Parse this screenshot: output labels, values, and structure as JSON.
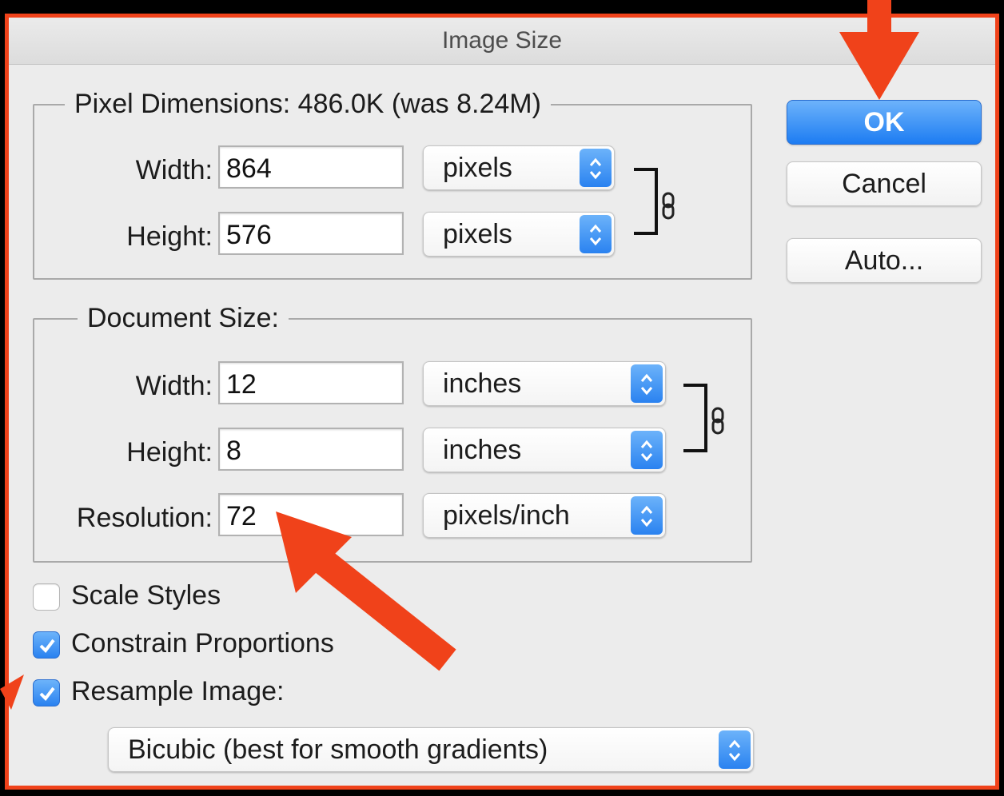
{
  "dialog": {
    "title": "Image Size"
  },
  "pixel_dimensions": {
    "legend": "Pixel Dimensions:  486.0K (was 8.24M)",
    "width_label": "Width:",
    "width_value": "864",
    "width_unit": "pixels",
    "height_label": "Height:",
    "height_value": "576",
    "height_unit": "pixels"
  },
  "document_size": {
    "legend": "Document Size:",
    "width_label": "Width:",
    "width_value": "12",
    "width_unit": "inches",
    "height_label": "Height:",
    "height_value": "8",
    "height_unit": "inches",
    "resolution_label": "Resolution:",
    "resolution_value": "72",
    "resolution_unit": "pixels/inch"
  },
  "buttons": {
    "ok": "OK",
    "cancel": "Cancel",
    "auto": "Auto..."
  },
  "options": {
    "scale_styles": {
      "label": "Scale Styles",
      "checked": false
    },
    "constrain_proportions": {
      "label": "Constrain Proportions",
      "checked": true
    },
    "resample_image": {
      "label": "Resample Image:",
      "checked": true
    }
  },
  "resample_method": {
    "selected": "Bicubic (best for smooth gradients)"
  },
  "colors": {
    "annotation_arrow": "#f0421a",
    "accent": "#2a82f0",
    "frame_border": "#f0421a"
  },
  "icons": [
    "chain-link-icon",
    "stepper-arrows-icon",
    "checkmark-icon",
    "annotation-arrow"
  ]
}
